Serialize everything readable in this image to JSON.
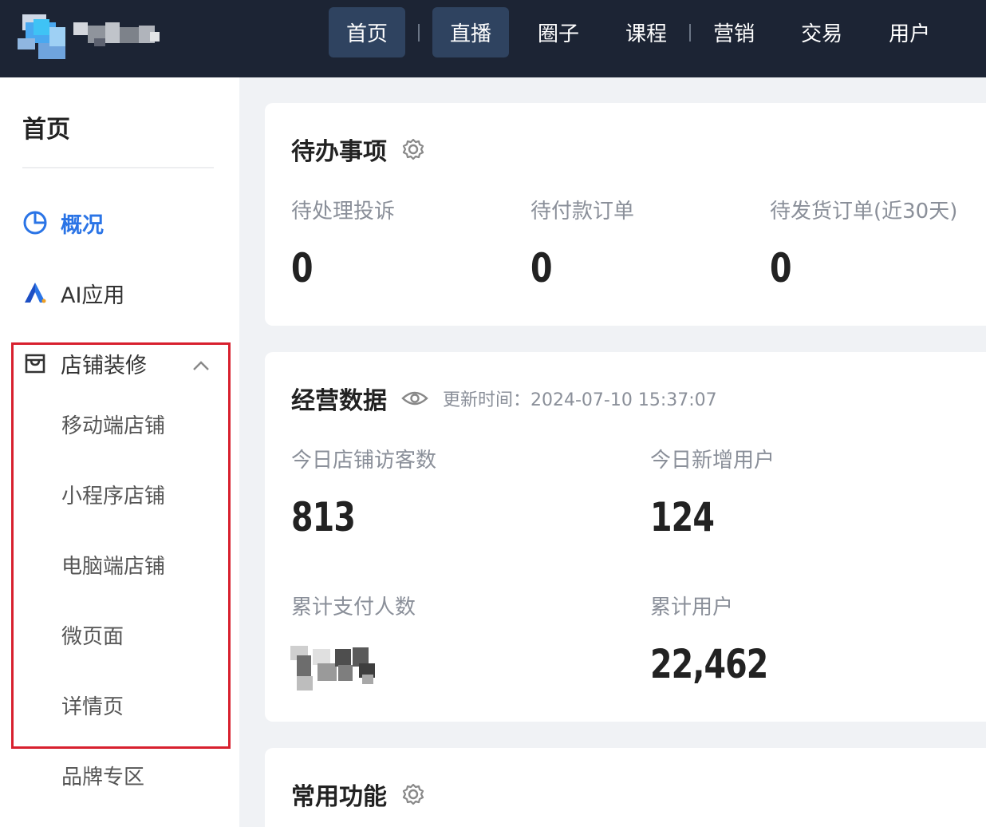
{
  "topbar": {
    "nav": [
      {
        "label": "首页",
        "active": true
      },
      {
        "label": "直播",
        "active": true
      },
      {
        "label": "圈子",
        "active": false
      },
      {
        "label": "课程",
        "active": false
      },
      {
        "label": "营销",
        "active": false
      },
      {
        "label": "交易",
        "active": false
      },
      {
        "label": "用户",
        "active": false
      }
    ]
  },
  "sidebar": {
    "title": "首页",
    "items": [
      {
        "label": "概况",
        "icon": "pie-chart-icon",
        "active": true
      },
      {
        "label": "AI应用",
        "icon": "ai-logo-icon",
        "active": false
      },
      {
        "label": "店铺装修",
        "icon": "store-icon",
        "active": false,
        "expanded": true
      }
    ],
    "sub_items": [
      "移动端店铺",
      "小程序店铺",
      "电脑端店铺",
      "微页面",
      "详情页"
    ],
    "extra_item": "品牌专区"
  },
  "todo": {
    "title": "待办事项",
    "stats": [
      {
        "label": "待处理投诉",
        "value": "0"
      },
      {
        "label": "待付款订单",
        "value": "0"
      },
      {
        "label": "待发货订单(近30天)",
        "value": "0"
      }
    ]
  },
  "business": {
    "title": "经营数据",
    "update_time": "更新时间：2024-07-10 15:37:07",
    "stats": [
      {
        "label": "今日店铺访客数",
        "value": "813"
      },
      {
        "label": "今日新增用户",
        "value": "124"
      },
      {
        "label": "累计支付人数",
        "value": ""
      },
      {
        "label": "累计用户",
        "value": "22,462"
      }
    ]
  },
  "common": {
    "title": "常用功能"
  },
  "colors": {
    "topbar_bg": "#1c2434",
    "accent": "#2a74e6",
    "highlight_border": "#d8202e"
  }
}
